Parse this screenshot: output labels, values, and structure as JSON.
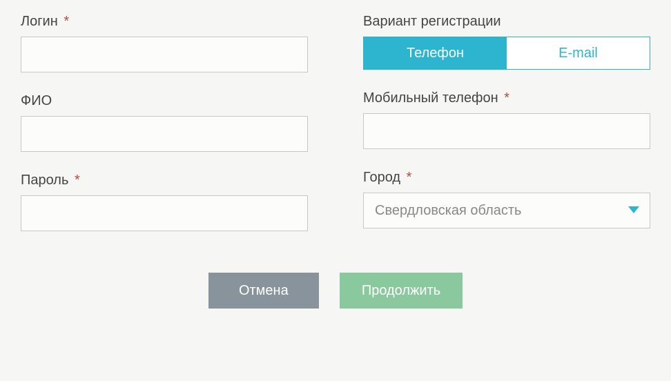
{
  "left": {
    "login": {
      "label": "Логин",
      "required": true,
      "value": ""
    },
    "fio": {
      "label": "ФИО",
      "required": false,
      "value": ""
    },
    "password": {
      "label": "Пароль",
      "required": true,
      "value": ""
    }
  },
  "right": {
    "regVariant": {
      "label": "Вариант регистрации",
      "options": {
        "phone": "Телефон",
        "email": "E-mail"
      },
      "active": "phone"
    },
    "mobile": {
      "label": "Мобильный телефон",
      "required": true,
      "value": ""
    },
    "city": {
      "label": "Город",
      "required": true,
      "selected": "Свердловская область"
    }
  },
  "buttons": {
    "cancel": "Отмена",
    "continue": "Продолжить"
  },
  "requiredMark": "*"
}
